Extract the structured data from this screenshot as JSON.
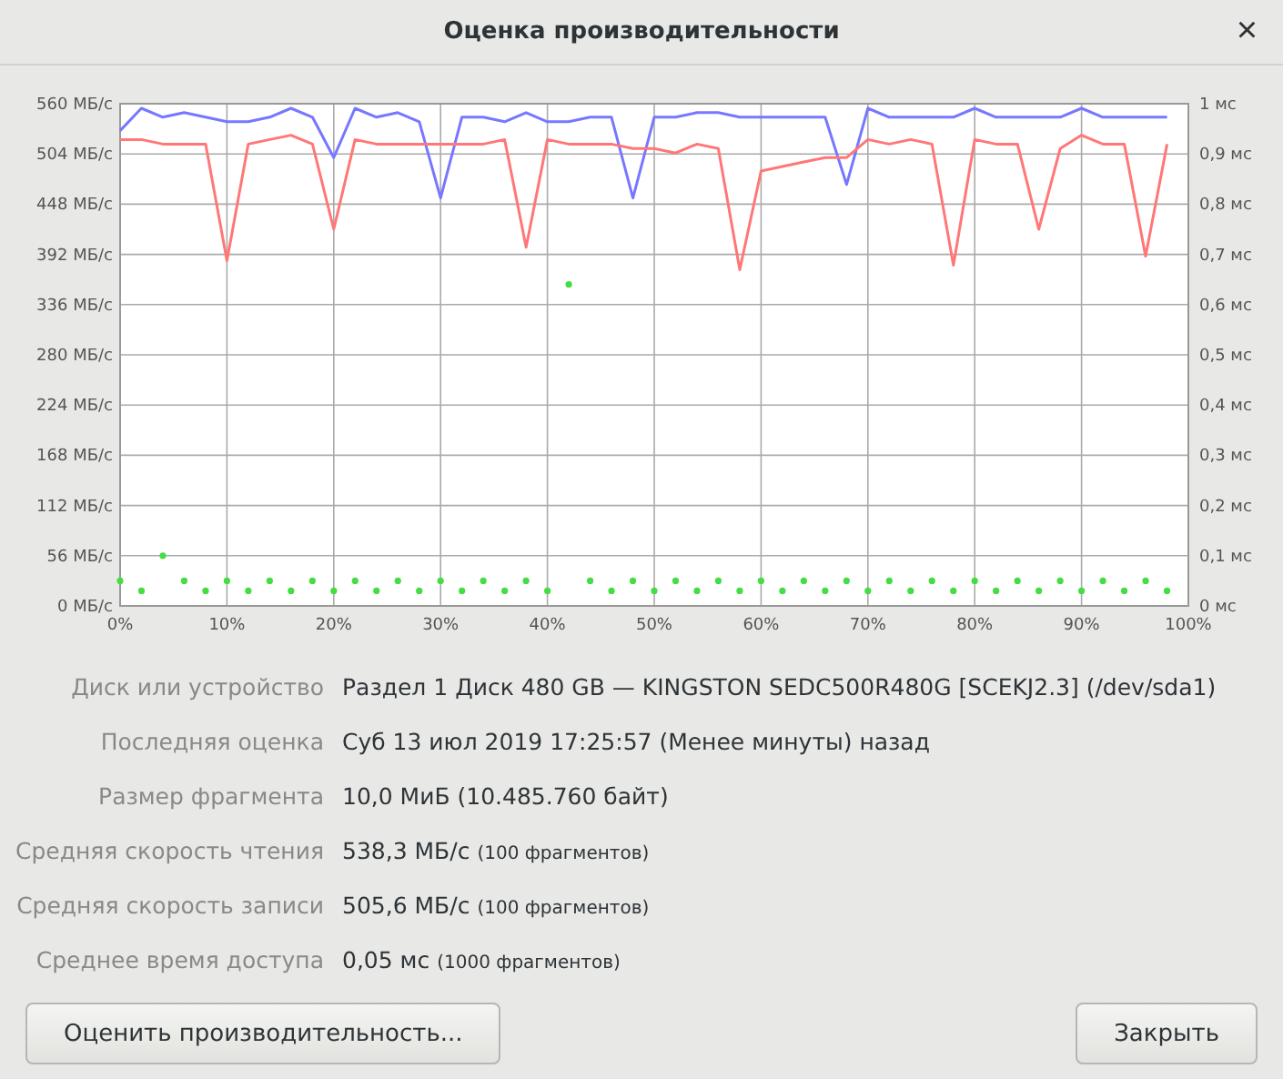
{
  "window": {
    "title": "Оценка производительности",
    "close": "×"
  },
  "chart": {
    "chart_data": {
      "type": "line",
      "x": [
        0,
        2,
        4,
        6,
        8,
        10,
        12,
        14,
        16,
        18,
        20,
        22,
        24,
        26,
        28,
        30,
        32,
        34,
        36,
        38,
        40,
        42,
        44,
        46,
        48,
        50,
        52,
        54,
        56,
        58,
        60,
        62,
        64,
        66,
        68,
        70,
        72,
        74,
        76,
        78,
        80,
        82,
        84,
        86,
        88,
        90,
        92,
        94,
        96,
        98
      ],
      "series": [
        {
          "color": "#7777ff",
          "values": [
            530,
            555,
            545,
            550,
            545,
            540,
            540,
            545,
            555,
            545,
            500,
            555,
            545,
            550,
            540,
            455,
            545,
            545,
            540,
            550,
            540,
            540,
            545,
            545,
            455,
            545,
            545,
            550,
            550,
            545,
            545,
            545,
            545,
            545,
            470,
            555,
            545,
            545,
            545,
            545,
            555,
            545,
            545,
            545,
            545,
            555,
            545,
            545,
            545,
            545
          ]
        },
        {
          "color": "#ff7777",
          "values": [
            520,
            520,
            515,
            515,
            515,
            385,
            515,
            520,
            525,
            515,
            420,
            520,
            515,
            515,
            515,
            515,
            515,
            515,
            520,
            400,
            520,
            515,
            515,
            515,
            510,
            510,
            505,
            515,
            510,
            375,
            485,
            490,
            495,
            500,
            500,
            520,
            515,
            520,
            515,
            380,
            520,
            515,
            515,
            420,
            510,
            525,
            515,
            515,
            390,
            515
          ]
        },
        {
          "color": "#44dd44",
          "axis": "y2",
          "type": "scatter",
          "values": [
            0.05,
            0.03,
            0.1,
            0.05,
            0.03,
            0.05,
            0.03,
            0.05,
            0.03,
            0.05,
            0.03,
            0.05,
            0.03,
            0.05,
            0.03,
            0.05,
            0.03,
            0.05,
            0.03,
            0.05,
            0.03,
            0.64,
            0.05,
            0.03,
            0.05,
            0.03,
            0.05,
            0.03,
            0.05,
            0.03,
            0.05,
            0.03,
            0.05,
            0.03,
            0.05,
            0.03,
            0.05,
            0.03,
            0.05,
            0.03,
            0.05,
            0.03,
            0.05,
            0.03,
            0.05,
            0.03,
            0.05,
            0.03,
            0.05,
            0.03
          ]
        }
      ],
      "grid": true,
      "xlim": [
        0,
        100
      ],
      "ylim": [
        0,
        560
      ],
      "y2lim": [
        0,
        1
      ],
      "xticks": [
        {
          "value": 0,
          "label": "0%"
        },
        {
          "value": 10,
          "label": "10%"
        },
        {
          "value": 20,
          "label": "20%"
        },
        {
          "value": 30,
          "label": "30%"
        },
        {
          "value": 40,
          "label": "40%"
        },
        {
          "value": 50,
          "label": "50%"
        },
        {
          "value": 60,
          "label": "60%"
        },
        {
          "value": 70,
          "label": "70%"
        },
        {
          "value": 80,
          "label": "80%"
        },
        {
          "value": 90,
          "label": "90%"
        },
        {
          "value": 100,
          "label": "100%"
        }
      ],
      "yticks": [
        {
          "value": 560,
          "label": "560 МБ/с"
        },
        {
          "value": 504,
          "label": "504 МБ/с"
        },
        {
          "value": 448,
          "label": "448 МБ/с"
        },
        {
          "value": 392,
          "label": "392 МБ/с"
        },
        {
          "value": 336,
          "label": "336 МБ/с"
        },
        {
          "value": 280,
          "label": "280 МБ/с"
        },
        {
          "value": 224,
          "label": "224 МБ/с"
        },
        {
          "value": 168,
          "label": "168 МБ/с"
        },
        {
          "value": 112,
          "label": "112 МБ/с"
        },
        {
          "value": 56,
          "label": "56 МБ/с"
        },
        {
          "value": 0,
          "label": "0 МБ/с"
        }
      ],
      "y2ticks": [
        {
          "value": 1,
          "label": "1 мс"
        },
        {
          "value": 0.9,
          "label": "0,9 мс"
        },
        {
          "value": 0.8,
          "label": "0,8 мс"
        },
        {
          "value": 0.7,
          "label": "0,7 мс"
        },
        {
          "value": 0.6,
          "label": "0,6 мс"
        },
        {
          "value": 0.5,
          "label": "0,5 мс"
        },
        {
          "value": 0.4,
          "label": "0,4 мс"
        },
        {
          "value": 0.3,
          "label": "0,3 мс"
        },
        {
          "value": 0.2,
          "label": "0,2 мс"
        },
        {
          "value": 0.1,
          "label": "0,1 мс"
        },
        {
          "value": 0,
          "label": "0 мс"
        }
      ]
    }
  },
  "details": [
    {
      "label": "Диск или устройство",
      "value": "Раздел 1 Диск 480 GB — KINGSTON SEDC500R480G [SCEKJ2.3] (/dev/sda1)"
    },
    {
      "label": "Последняя оценка",
      "value": "Суб 13 июл 2019 17:25:57 (Менее минуты) назад"
    },
    {
      "label": "Размер фрагмента",
      "value": "10,0 МиБ (10.485.760 байт)"
    },
    {
      "label": "Средняя скорость чтения",
      "value": "538,3 МБ/с",
      "note": "(100 фрагментов)"
    },
    {
      "label": "Средняя скорость записи",
      "value": "505,6 МБ/с",
      "note": "(100 фрагментов)"
    },
    {
      "label": "Среднее время доступа",
      "value": "0,05 мс",
      "note": "(1000 фрагментов)"
    }
  ],
  "buttons": [
    {
      "label": "Оценить производительность..."
    },
    {
      "label": "Закрыть"
    }
  ]
}
